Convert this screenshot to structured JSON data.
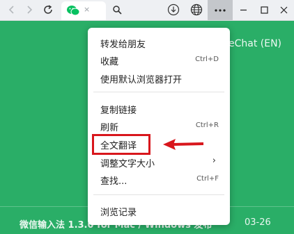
{
  "background": {
    "title": "eChat (EN)",
    "news_text": "微信输入法 1.3.0 for Mac / Windows 发布",
    "news_date": "03-26"
  },
  "toolbar": {
    "icons": [
      "back-icon",
      "forward-icon",
      "refresh-icon",
      "search-icon",
      "download-icon",
      "globe-icon",
      "more-icon"
    ],
    "tab_close": "×"
  },
  "menu": {
    "items": [
      {
        "label": "转发给朋友",
        "shortcut": ""
      },
      {
        "label": "收藏",
        "shortcut": "Ctrl+D"
      },
      {
        "label": "使用默认浏览器打开",
        "shortcut": ""
      },
      {
        "label": "复制链接",
        "shortcut": ""
      },
      {
        "label": "刷新",
        "shortcut": "Ctrl+R"
      },
      {
        "label": "全文翻译",
        "shortcut": ""
      },
      {
        "label": "调整文字大小",
        "shortcut": "",
        "submenu_arrow": "›"
      },
      {
        "label": "查找...",
        "shortcut": "Ctrl+F"
      },
      {
        "label": "浏览记录",
        "shortcut": ""
      }
    ]
  },
  "colors": {
    "background": "#2aae67",
    "highlight": "#d8161c",
    "wechat": "#07c160"
  }
}
